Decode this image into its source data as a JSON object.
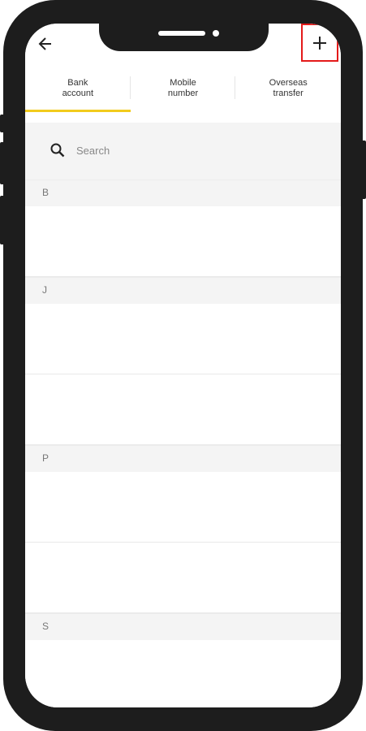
{
  "app_bar": {
    "back_icon": "arrow-left-icon",
    "add_icon": "plus-icon",
    "highlight_color": "#e41a1a"
  },
  "tabs": [
    {
      "label": "Bank\naccount",
      "active": true
    },
    {
      "label": "Mobile\nnumber",
      "active": false
    },
    {
      "label": "Overseas\ntransfer",
      "active": false
    }
  ],
  "accent_color": "#f2cb1d",
  "search": {
    "icon": "search-icon",
    "placeholder": "Search"
  },
  "sections": [
    {
      "letter": "B",
      "rows": 1
    },
    {
      "letter": "J",
      "rows": 2
    },
    {
      "letter": "P",
      "rows": 2
    },
    {
      "letter": "S",
      "rows": 1
    }
  ]
}
